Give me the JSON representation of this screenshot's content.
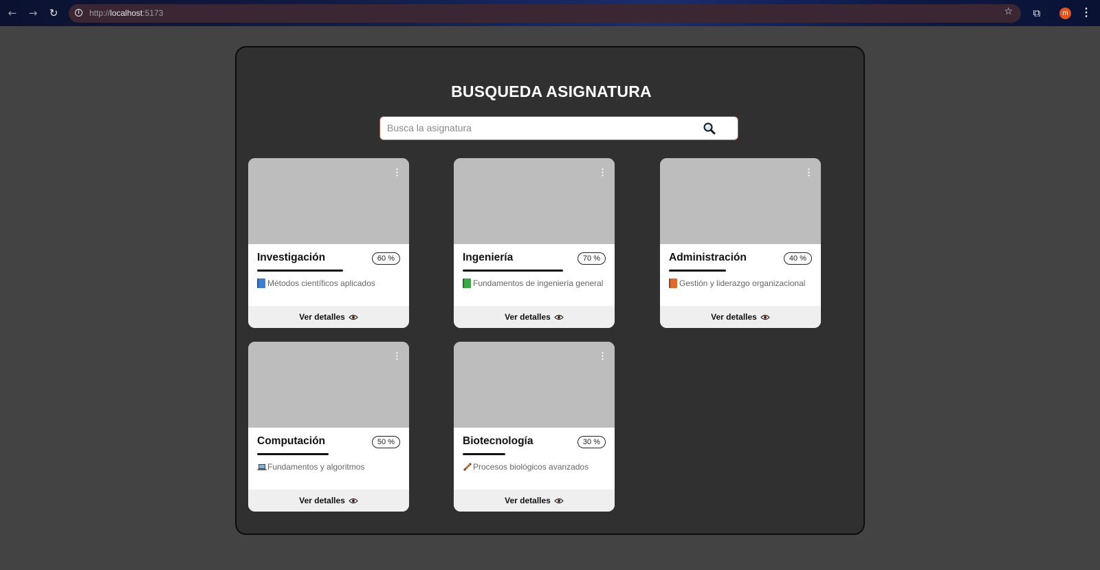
{
  "browser": {
    "url_scheme": "http://",
    "url_host": "localhost",
    "url_port": ":5173",
    "avatar_letter": "m",
    "avatar_color": "#e8511a"
  },
  "page": {
    "title": "BUSQUEDA ASIGNATURA",
    "search": {
      "placeholder": "Busca la asignatura",
      "value": ""
    }
  },
  "cards": [
    {
      "title": "Investigación",
      "percent_label": "60 %",
      "progress": 0.6,
      "description": "Métodos científicos aplicados",
      "icon": "blue-book-icon",
      "icon_color": "#3f7fd0",
      "details_label": "Ver detalles"
    },
    {
      "title": "Ingeniería",
      "percent_label": "70 %",
      "progress": 0.7,
      "description": "Fundamentos de ingeniería general",
      "icon": "green-book-icon",
      "icon_color": "#3aa843",
      "details_label": "Ver detalles"
    },
    {
      "title": "Administración",
      "percent_label": "40 %",
      "progress": 0.4,
      "description": "Gestión y liderazgo organizacional",
      "icon": "orange-book-icon",
      "icon_color": "#e3692b",
      "details_label": "Ver detalles"
    },
    {
      "title": "Computación",
      "percent_label": "50 %",
      "progress": 0.5,
      "description": "Fundamentos y algoritmos",
      "icon": "laptop-icon",
      "icon_color": "#555555",
      "details_label": "Ver detalles"
    },
    {
      "title": "Biotecnología",
      "percent_label": "30 %",
      "progress": 0.3,
      "description": "Procesos biológicos avanzados",
      "icon": "dna-icon",
      "icon_color": "#8a4a2a",
      "details_label": "Ver detalles"
    }
  ]
}
